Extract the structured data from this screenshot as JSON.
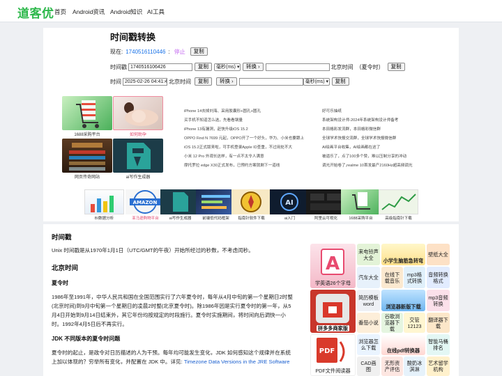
{
  "site": {
    "logo": "道客优",
    "nav": [
      "首页",
      "Android资讯",
      "Android知识",
      "AI工具"
    ]
  },
  "tool": {
    "title": "时间戳转换",
    "now_label": "现在:",
    "now_value": "1740516110446",
    "now_sep": ":",
    "stop_label": "停止",
    "copy_label": "复制",
    "ts_label": "时间戳",
    "ts_input": "1740516106426",
    "unit_option": "毫秒(ms)",
    "convert_label": "转换 ›",
    "beijing_label": "北京时间",
    "dst_label": "（夏令时）",
    "time_label": "时间",
    "time_input": "2025-02-26 04:41:46",
    "beijing_label2": "北京时间",
    "unit_option2": "毫秒(ms)"
  },
  "ads": {
    "big": [
      {
        "caption": "1688采购平台",
        "icon": "shopping-cart-ad"
      },
      {
        "caption": "如何助孕",
        "icon": "pregnancy-ad"
      },
      {
        "caption": "网页传奇网站",
        "icon": "game-upgrades-ad"
      },
      {
        "caption": "ai写作生成器",
        "icon": "ai-pen-ad"
      }
    ],
    "links_left": [
      "iPhone 14去掉刘海、采用胶囊形+圆孔+圆孔",
      "买手机不知道怎么选，先看看钢量",
      "iPhone 13有漏洞，赶快升级iOS 15.2",
      "OPPO Find N 7699 元起，OPPO开了一个好头，华为、小米也要跟上",
      "iOS 15.2正式版来啦，可手机登录Apple ID查重，不过用处不大",
      "小米 12 Pro 外观长这样，有一点不太令人满意",
      "摩托罗拉 edge X30正式发布，已预约方案就剩下一道线"
    ],
    "links_right": [
      "好可乐抽纸",
      "系统架构设计师-2024年系统架构设计师备考",
      "本田格彩发流群，本田格彩微信群",
      "全球学术快报交流群，全球学术快报微信群",
      "AI绘画平台收集，AI绘画都在这了",
      "被逼乐了，点了100多个赞，难以压制分享的冲动",
      "调光开始卷了,realme 10首发最产2160Hz超高频调光"
    ],
    "row": [
      {
        "caption": "BI数据分析"
      },
      {
        "caption": "亚马逊购物平台"
      },
      {
        "caption": "ai写作生成器"
      },
      {
        "caption": "前端低代码框架"
      },
      {
        "caption": "指南针软件下载"
      },
      {
        "caption": "ai入门"
      },
      {
        "caption": "阿里云可视化"
      },
      {
        "caption": "1688采购平台"
      },
      {
        "caption": "高级指南针下载"
      }
    ]
  },
  "article": {
    "h1": "时间戳",
    "p1": "Unix 时间戳是从1970年1月1日（UTC/GMT的午夜）开始所经过的秒数，不考虑闰秒。",
    "h2": "北京时间",
    "h3": "夏令时",
    "p2": "1986年至1991年，中华人民共和国在全国范围实行了六年夏令时，每年从4月中旬的第一个星期日2时整(北京时间)到9月中旬第一个星期日的凌晨2时整(北京夏令时)。除1986年因是实行夏令时的第一年，从5月4日开始到9月14日结束外，其它年份均按规定的时段施行。夏令时实施期间，将时间向后调快一小时。1992年4月5日后不再实行。",
    "h4": "JDK 不同版本的夏令时问题",
    "p3": "夏令时的起止，是政令对日历描述的人为干预。每年均可能发生变化，JDK 如何感知这个规律并在系统上加以体现的？穷举所有变化，并配置在 JDK 中。详见: ",
    "p3_link": "Timezone Data Versions in the JRE Software"
  },
  "sidebar": {
    "tiles": [
      {
        "label": "学英语26个字母"
      },
      {
        "label": "来电铃声大全"
      },
      {
        "label": "小学生脑筋急转弯"
      },
      {
        "label": "壁纸大全"
      },
      {
        "label": "汽车大全"
      },
      {
        "label": "在线下载音乐"
      },
      {
        "label": "mp3格式转换"
      },
      {
        "label": "音频转换格式"
      },
      {
        "label": "简历模板word"
      },
      {
        "label": "浏览器新版下载"
      },
      {
        "label": "mp3音频转换"
      },
      {
        "label": "拼多多商家版"
      },
      {
        "label": "番茄小说"
      },
      {
        "label": "谷歌浏览器下载"
      },
      {
        "label": "交管12123"
      },
      {
        "label": "翻译器下载"
      },
      {
        "label": "PDF文件阅读器"
      },
      {
        "label": "浏览器怎么下载"
      },
      {
        "label": "在线pdf转换器"
      },
      {
        "label": "智能马桶排名"
      },
      {
        "label": "CAD画图"
      },
      {
        "label": "无形资产评估"
      },
      {
        "label": "酸奶冰淇淋"
      },
      {
        "label": "艺术留学机构"
      }
    ]
  }
}
